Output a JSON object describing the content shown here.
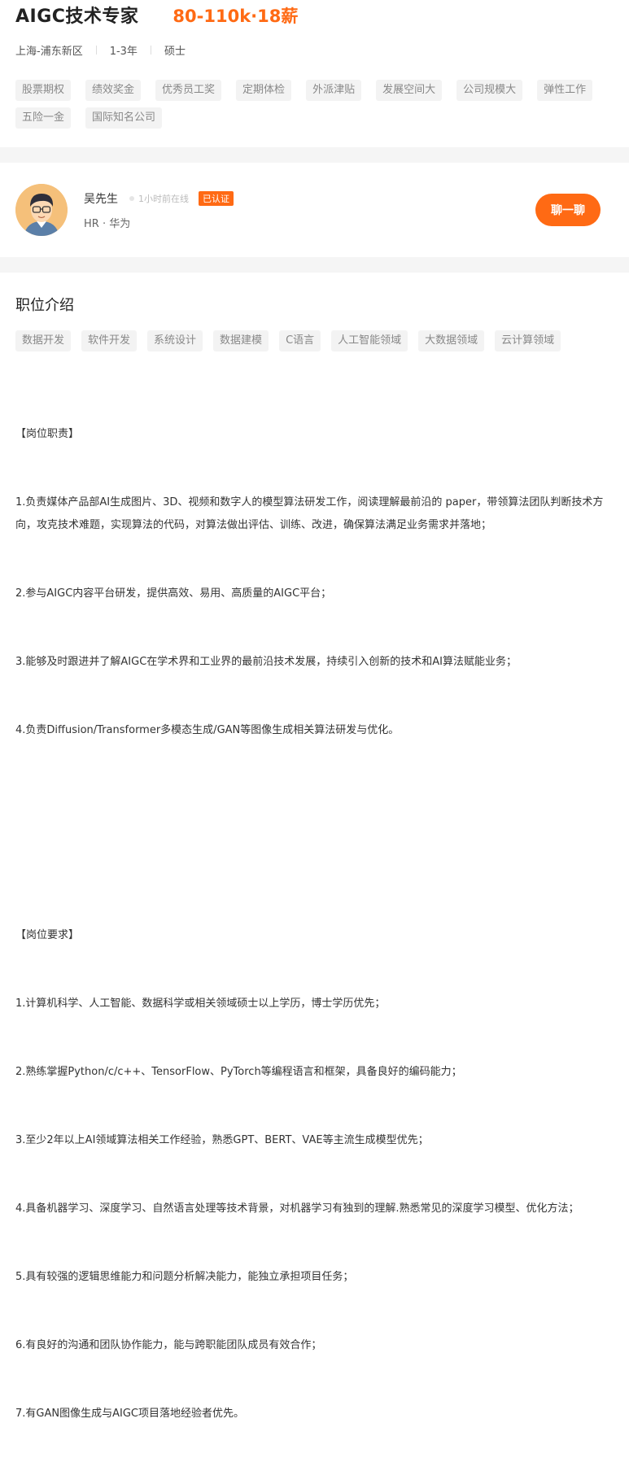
{
  "job": {
    "title": "AIGC技术专家",
    "salary": "80-110k·18薪",
    "location": "上海-浦东新区",
    "experience": "1-3年",
    "degree": "硕士",
    "benefits": [
      "股票期权",
      "绩效奖金",
      "优秀员工奖",
      "定期体检",
      "外派津贴",
      "发展空间大",
      "公司规模大",
      "弹性工作",
      "五险一金",
      "国际知名公司"
    ]
  },
  "recruiter": {
    "name": "吴先生",
    "status": "1小时前在线",
    "badge": "已认证",
    "role_company": "HR · 华为",
    "chat_label": "聊一聊",
    "avatar_icon": "avatar-icon"
  },
  "intro": {
    "title": "职位介绍",
    "skills": [
      "数据开发",
      "软件开发",
      "系统设计",
      "数据建模",
      "C语言",
      "人工智能领域",
      "大数据领域",
      "云计算领域"
    ],
    "responsibilities": [
      "【岗位职责】",
      "1.负责媒体产品部AI生成图片、3D、视频和数字人的模型算法研发工作，阅读理解最前沿的 paper，带领算法团队判断技术方向，攻克技术难题，实现算法的代码，对算法做出评估、训练、改进，确保算法满足业务需求并落地；",
      "2.参与AIGC内容平台研发，提供高效、易用、高质量的AIGC平台；",
      "3.能够及时跟进并了解AIGC在学术界和工业界的最前沿技术发展，持续引入创新的技术和AI算法赋能业务；",
      "4.负责Diffusion/Transformer多模态生成/GAN等图像生成相关算法研发与优化。"
    ],
    "requirements": [
      "【岗位要求】",
      "1.计算机科学、人工智能、数据科学或相关领域硕士以上学历，博士学历优先；",
      "2.熟练掌握Python/c/c++、TensorFlow、PyTorch等编程语言和框架，具备良好的编码能力；",
      "3.至少2年以上AI领域算法相关工作经验，熟悉GPT、BERT、VAE等主流生成模型优先；",
      "4.具备机器学习、深度学习、自然语言处理等技术背景，对机器学习有独到的理解.熟悉常见的深度学习模型、优化方法；",
      "5.具有较强的逻辑思维能力和问题分析解决能力，能独立承担项目任务；",
      "6.有良好的沟通和团队协作能力，能与跨职能团队成员有效合作；",
      "7.有GAN图像生成与AIGC项目落地经验者优先。"
    ]
  },
  "colors": {
    "accent": "#ff6a14",
    "tag_bg": "#f3f3f3",
    "tag_text": "#888888"
  }
}
